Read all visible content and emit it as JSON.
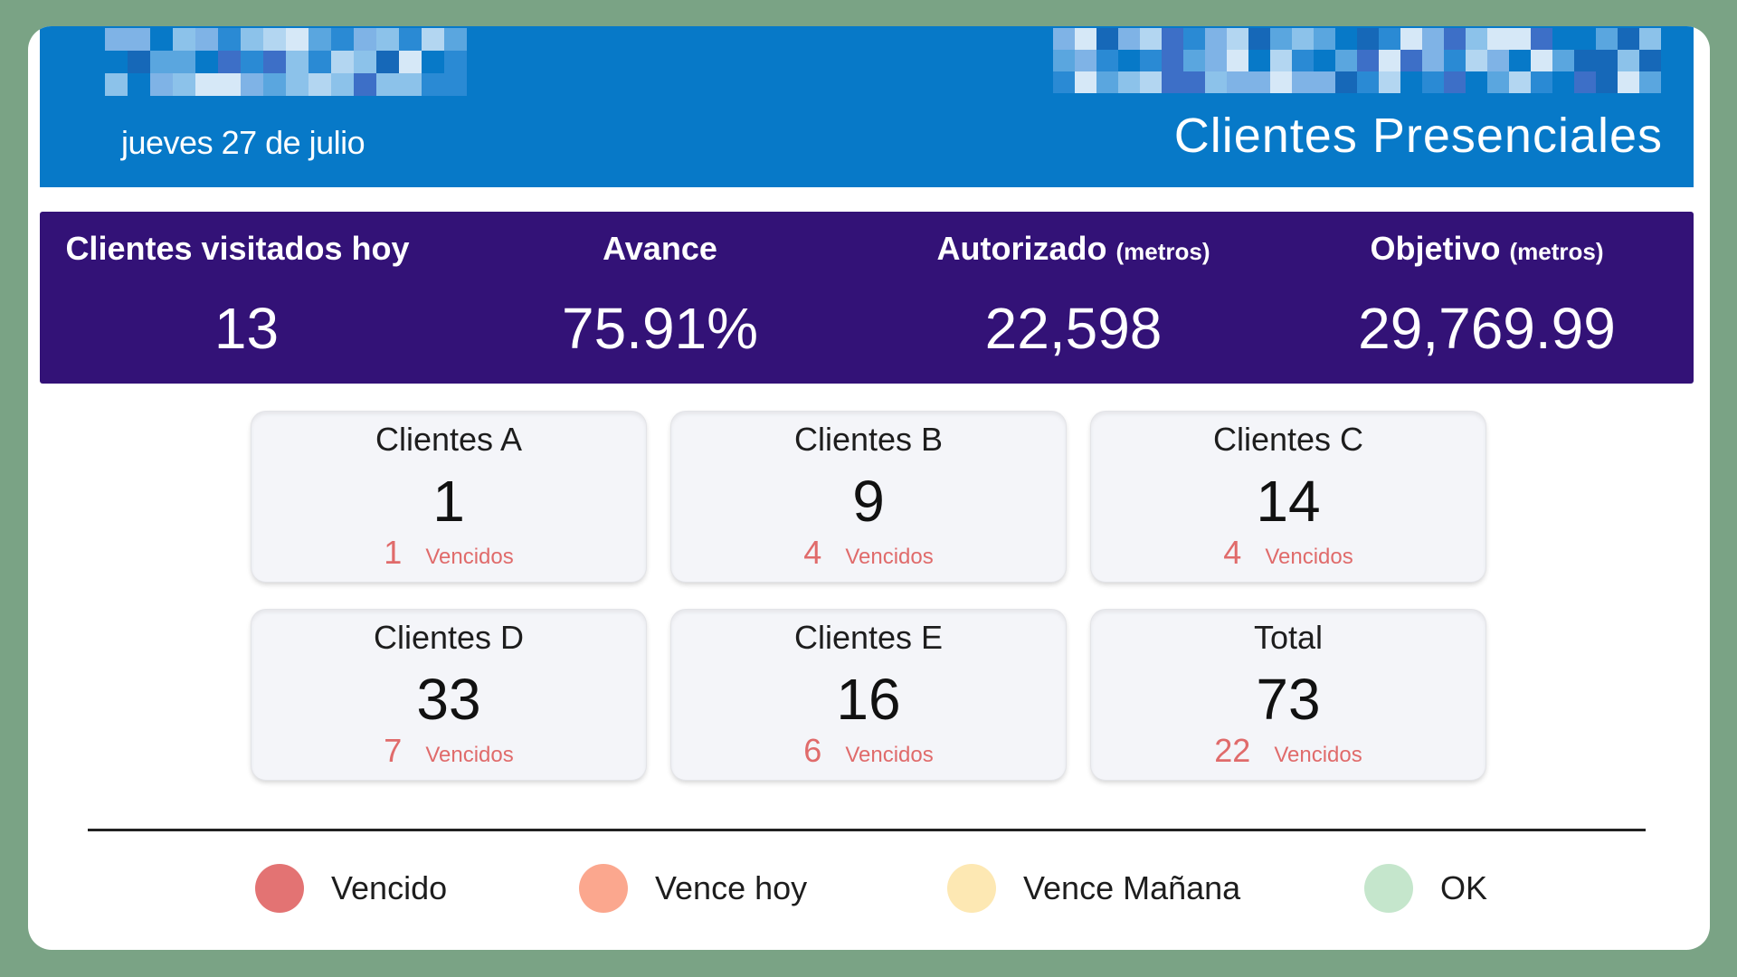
{
  "header": {
    "date": "jueves 27 de julio",
    "title": "Clientes Presenciales",
    "brand_color": "#0779c8"
  },
  "kpis": [
    {
      "label": "Clientes visitados hoy",
      "unit": "",
      "value": "13"
    },
    {
      "label": "Avance",
      "unit": "",
      "value": "75.91%"
    },
    {
      "label": "Autorizado",
      "unit": "(metros)",
      "value": "22,598"
    },
    {
      "label": "Objetivo",
      "unit": "(metros)",
      "value": "29,769.99"
    }
  ],
  "kpi_band_color": "#331277",
  "tiles": [
    {
      "title": "Clientes A",
      "count": "1",
      "overdue": "1",
      "overdue_label": "Vencidos"
    },
    {
      "title": "Clientes B",
      "count": "9",
      "overdue": "4",
      "overdue_label": "Vencidos"
    },
    {
      "title": "Clientes C",
      "count": "14",
      "overdue": "4",
      "overdue_label": "Vencidos"
    },
    {
      "title": "Clientes D",
      "count": "33",
      "overdue": "7",
      "overdue_label": "Vencidos"
    },
    {
      "title": "Clientes E",
      "count": "16",
      "overdue": "6",
      "overdue_label": "Vencidos"
    },
    {
      "title": "Total",
      "count": "73",
      "overdue": "22",
      "overdue_label": "Vencidos"
    }
  ],
  "legend": [
    {
      "label": "Vencido",
      "color": "#e37373"
    },
    {
      "label": "Vence hoy",
      "color": "#fba78e"
    },
    {
      "label": "Vence Mañana",
      "color": "#fde8b3"
    },
    {
      "label": "OK",
      "color": "#c5e6cc"
    }
  ]
}
